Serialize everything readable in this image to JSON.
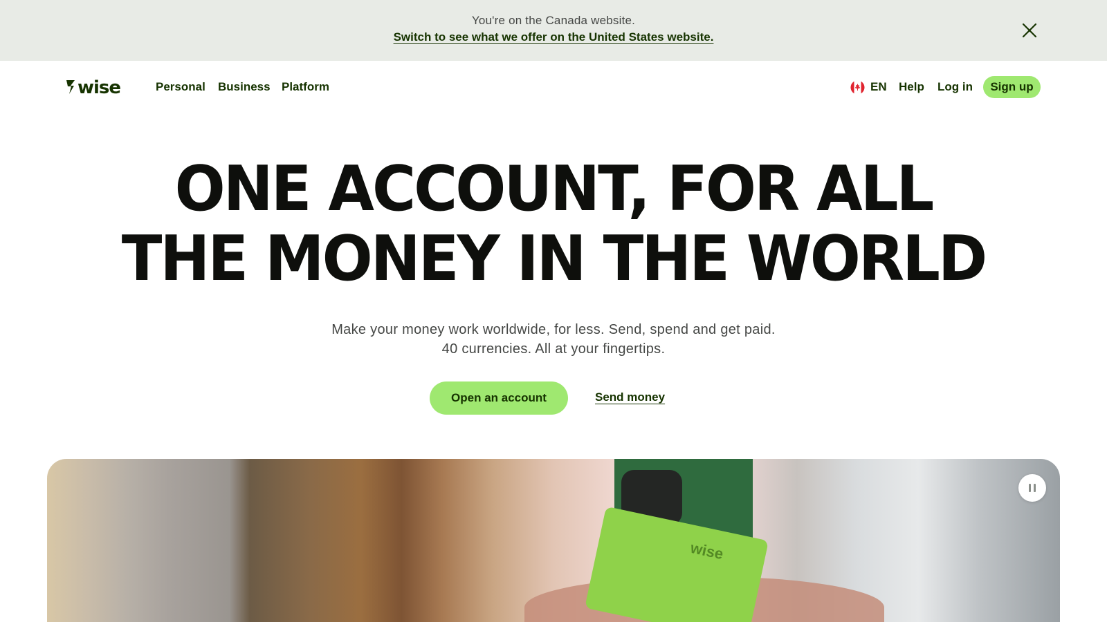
{
  "banner": {
    "message": "You're on the Canada website.",
    "link_text": "Switch to see what we offer on the United States website.",
    "close_icon": "close-icon"
  },
  "header": {
    "logo_text": "7WISE",
    "nav": {
      "personal": "Personal",
      "business": "Business",
      "platform": "Platform"
    },
    "language": {
      "flag_icon": "canada-flag-icon",
      "label": "EN"
    },
    "help": "Help",
    "login": "Log in",
    "signup": "Sign up"
  },
  "hero": {
    "title_line1": "ONE ACCOUNT, FOR ALL",
    "title_line2": "THE MONEY IN THE WORLD",
    "subtitle_line1": "Make your money work worldwide, for less. Send, spend and get paid.",
    "subtitle_line2": "40 currencies. All at your fingertips.",
    "primary_cta": "Open an account",
    "secondary_cta": "Send money"
  },
  "media": {
    "pause_icon": "pause-icon",
    "card_text": "wise"
  },
  "colors": {
    "accent": "#9fe870",
    "brand_dark": "#163300",
    "banner_bg": "#e8ebe6",
    "title_text": "#0e0f0c"
  }
}
